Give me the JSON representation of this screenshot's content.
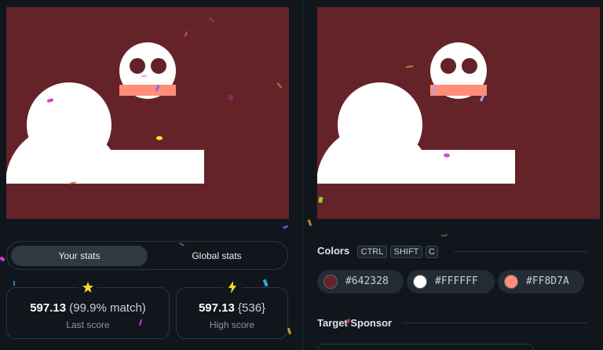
{
  "colors": {
    "background": "#642328",
    "snowman": "#FFFFFF",
    "scarf": "#FF8D7A",
    "eyes": "#642328"
  },
  "stats": {
    "tabs": [
      {
        "label": "Your stats",
        "active": true
      },
      {
        "label": "Global stats",
        "active": false
      }
    ],
    "last": {
      "score": "597.13",
      "match": "(99.9% match)",
      "label": "Last score",
      "icon": "star-icon"
    },
    "high": {
      "score": "597.13",
      "rank": "{536}",
      "label": "High score",
      "icon": "lightning-icon"
    }
  },
  "colors_section": {
    "title": "Colors",
    "shortcut_keys": [
      "CTRL",
      "SHIFT",
      "C"
    ],
    "swatches": [
      {
        "hex": "#642328"
      },
      {
        "hex": "#FFFFFF"
      },
      {
        "hex": "#FF8D7A"
      }
    ]
  },
  "sponsor": {
    "title": "Target Sponsor"
  }
}
